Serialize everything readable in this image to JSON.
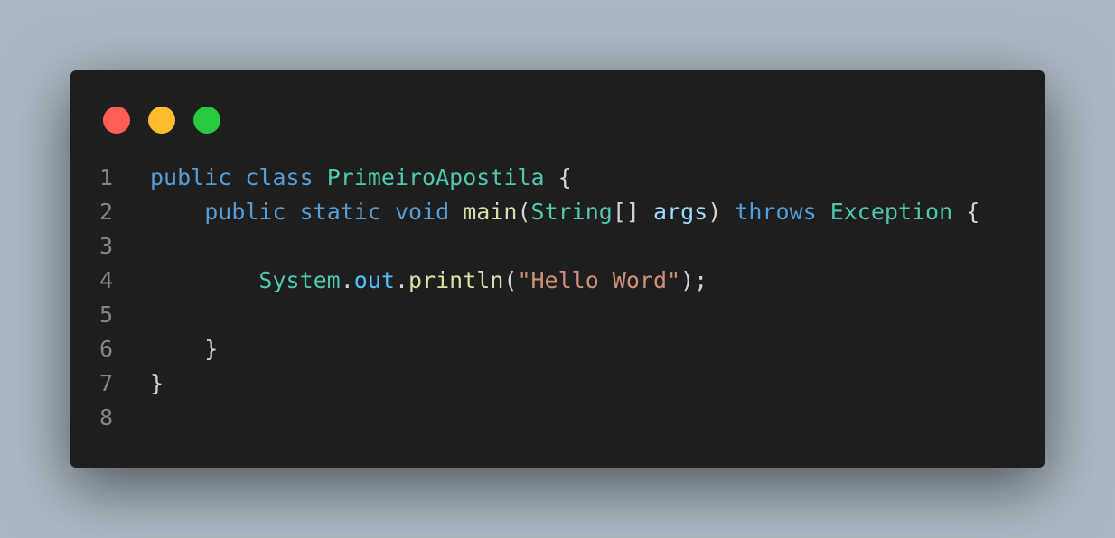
{
  "colors": {
    "background": "#abb8c3",
    "window": "#1e1e1e",
    "close_dot": "#ff5f56",
    "minimize_dot": "#ffbd2e",
    "maximize_dot": "#27c93f",
    "keyword": "#569cd6",
    "type": "#4ec9b0",
    "function": "#dcdcaa",
    "variable": "#9cdcfe",
    "field": "#4fc1ff",
    "string": "#ce9178",
    "plain": "#d4d4d4",
    "line_number": "#858585"
  },
  "window_controls": [
    {
      "name": "close-dot"
    },
    {
      "name": "minimize-dot"
    },
    {
      "name": "maximize-dot"
    }
  ],
  "code": {
    "language": "java",
    "lines": [
      {
        "number": "1",
        "tokens": [
          {
            "t": "public",
            "c": "kw"
          },
          {
            "t": " "
          },
          {
            "t": "class",
            "c": "kw"
          },
          {
            "t": " "
          },
          {
            "t": "PrimeiroApostila",
            "c": "type"
          },
          {
            "t": " {",
            "c": "punc"
          }
        ]
      },
      {
        "number": "2",
        "tokens": [
          {
            "t": "    "
          },
          {
            "t": "public",
            "c": "kw"
          },
          {
            "t": " "
          },
          {
            "t": "static",
            "c": "kw"
          },
          {
            "t": " "
          },
          {
            "t": "void",
            "c": "kw"
          },
          {
            "t": " "
          },
          {
            "t": "main",
            "c": "fn"
          },
          {
            "t": "(",
            "c": "punc"
          },
          {
            "t": "String",
            "c": "type"
          },
          {
            "t": "[] ",
            "c": "punc"
          },
          {
            "t": "args",
            "c": "var"
          },
          {
            "t": ") ",
            "c": "punc"
          },
          {
            "t": "throws",
            "c": "kw"
          },
          {
            "t": " "
          },
          {
            "t": "Exception",
            "c": "type"
          },
          {
            "t": " {",
            "c": "punc"
          }
        ]
      },
      {
        "number": "3",
        "tokens": []
      },
      {
        "number": "4",
        "tokens": [
          {
            "t": "        "
          },
          {
            "t": "System",
            "c": "type"
          },
          {
            "t": ".",
            "c": "punc"
          },
          {
            "t": "out",
            "c": "field"
          },
          {
            "t": ".",
            "c": "punc"
          },
          {
            "t": "println",
            "c": "fn"
          },
          {
            "t": "(",
            "c": "punc"
          },
          {
            "t": "\"Hello Word\"",
            "c": "str"
          },
          {
            "t": ");",
            "c": "punc"
          }
        ]
      },
      {
        "number": "5",
        "tokens": []
      },
      {
        "number": "6",
        "tokens": [
          {
            "t": "    "
          },
          {
            "t": "}",
            "c": "punc"
          }
        ]
      },
      {
        "number": "7",
        "tokens": [
          {
            "t": "}",
            "c": "punc"
          }
        ]
      },
      {
        "number": "8",
        "tokens": []
      }
    ]
  }
}
